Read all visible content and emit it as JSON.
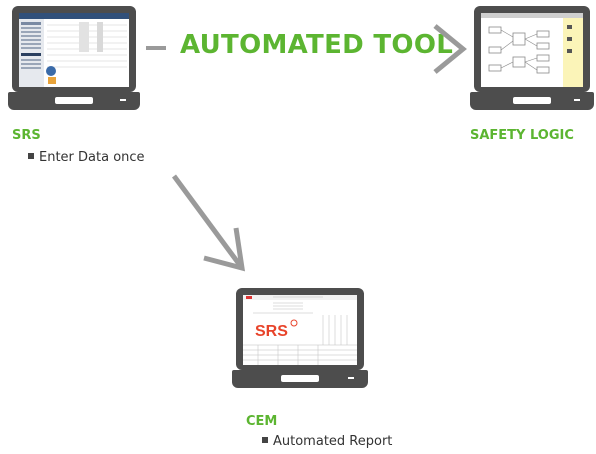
{
  "title": "AUTOMATED TOOL",
  "srs": {
    "label": "SRS",
    "bullet": "Enter Data once"
  },
  "safety_logic": {
    "label": "SAFETY LOGIC"
  },
  "cem": {
    "label": "CEM",
    "bullet": "Automated Report"
  },
  "report_logo": "SRS",
  "colors": {
    "accent": "#5cb531",
    "arrow": "#9a9a9a",
    "laptop": "#4d4d4d"
  }
}
